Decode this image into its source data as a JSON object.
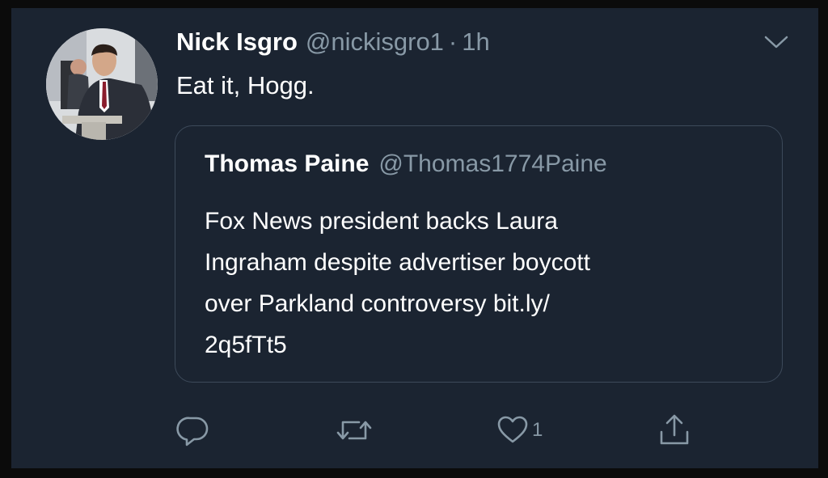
{
  "tweet": {
    "author_name": "Nick Isgro",
    "author_handle": "@nickisgro1",
    "separator": "·",
    "time": "1h",
    "text": "Eat it, Hogg."
  },
  "quoted_tweet": {
    "author_name": "Thomas Paine",
    "author_handle": "@Thomas1774Paine",
    "text_lines": [
      "Fox News president backs Laura",
      "Ingraham despite advertiser boycott",
      "over Parkland controversy bit.ly/",
      "2q5fTt5"
    ]
  },
  "actions": {
    "reply_icon": "reply-icon",
    "retweet_icon": "retweet-icon",
    "like_icon": "heart-icon",
    "like_count": "1",
    "share_icon": "share-icon"
  },
  "colors": {
    "background": "#1b2431",
    "primary_text": "#ffffff",
    "secondary_text": "#8899a6",
    "card_border": "#3d4a5a"
  }
}
